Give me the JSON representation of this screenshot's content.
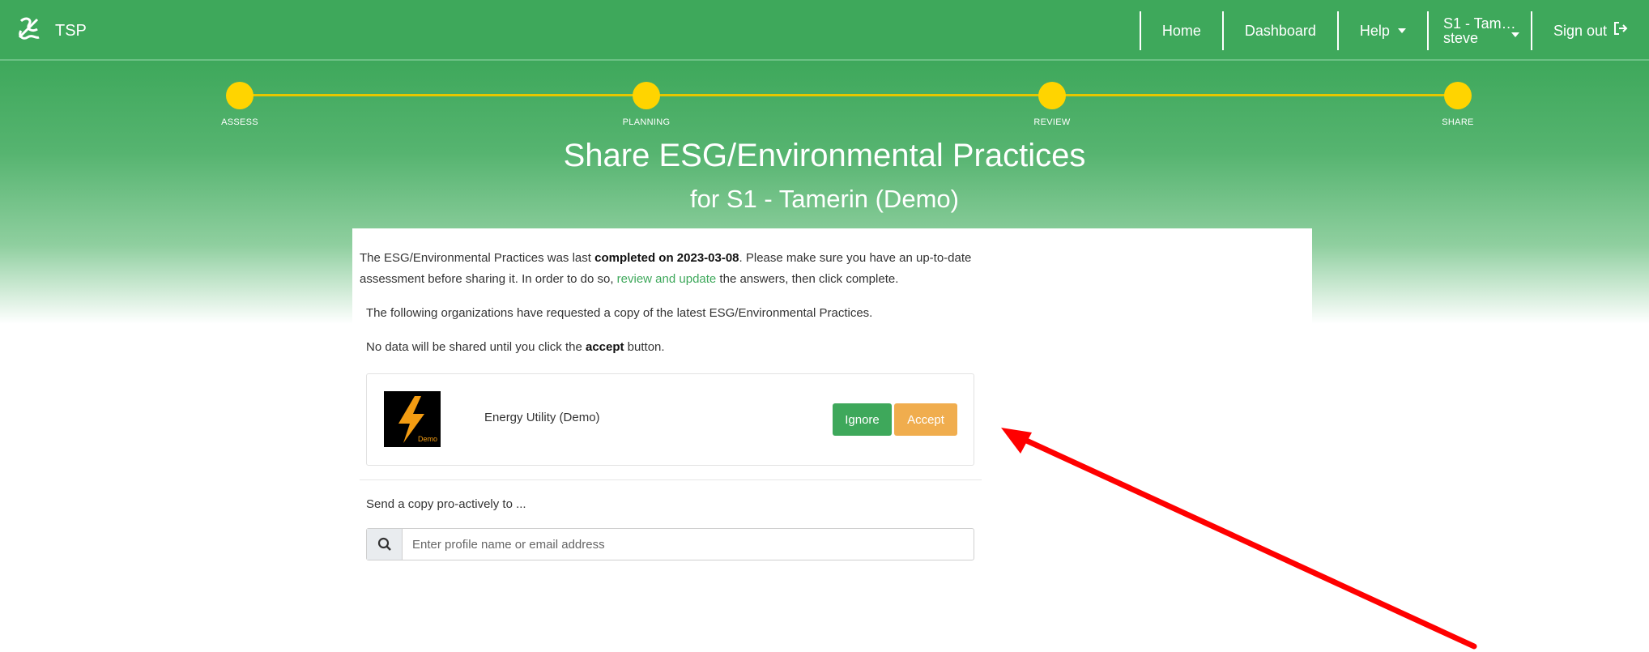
{
  "app": {
    "brand": "TSP"
  },
  "nav": {
    "home": "Home",
    "dashboard": "Dashboard",
    "help": "Help",
    "user_line1": "S1 - Tam…",
    "user_line2": "steve",
    "signout": "Sign out"
  },
  "stepper": {
    "steps": [
      "ASSESS",
      "PLANNING",
      "REVIEW",
      "SHARE"
    ],
    "color": "#ffd400"
  },
  "header": {
    "title": "Share ESG/Environmental Practices",
    "subtitle": "for S1 - Tamerin (Demo)"
  },
  "content": {
    "intro_a": "The ESG/Environmental Practices was last ",
    "intro_bold": "completed on 2023-03-08",
    "intro_b": ". Please make sure you have an up-to-date assessment before sharing it. In order to do so, ",
    "intro_link": "review and update",
    "intro_c": " the answers, then click complete.",
    "requested": "The following organizations have requested a copy of the latest ESG/Environmental Practices.",
    "nodata_a": "No data will be shared until you click the ",
    "nodata_bold": "accept",
    "nodata_b": " button."
  },
  "request": {
    "org_name": "Energy Utility (Demo)",
    "logo_text": "Demo",
    "ignore_label": "Ignore",
    "accept_label": "Accept"
  },
  "send": {
    "label": "Send a copy pro-actively to ...",
    "placeholder": "Enter profile name or email address"
  },
  "colors": {
    "primary": "#3ea85b",
    "accept": "#f0ad4e",
    "annotation_arrow": "#ff0000"
  }
}
